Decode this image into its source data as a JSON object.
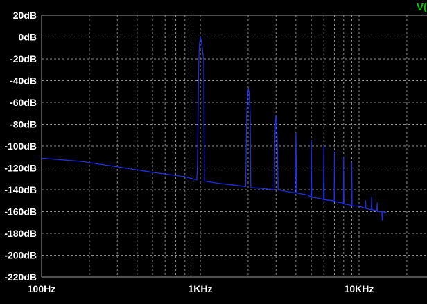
{
  "chart_data": {
    "type": "line",
    "title": "",
    "xlabel": "",
    "ylabel": "",
    "x_scale": "log",
    "xlim": [
      100,
      15000
    ],
    "ylim": [
      -220,
      20
    ],
    "grid": true,
    "y_ticks": [
      {
        "value": 20,
        "label": "20dB"
      },
      {
        "value": 0,
        "label": "0dB"
      },
      {
        "value": -20,
        "label": "-20dB"
      },
      {
        "value": -40,
        "label": "-40dB"
      },
      {
        "value": -60,
        "label": "-60dB"
      },
      {
        "value": -80,
        "label": "-80dB"
      },
      {
        "value": -100,
        "label": "-100dB"
      },
      {
        "value": -120,
        "label": "-120dB"
      },
      {
        "value": -140,
        "label": "-140dB"
      },
      {
        "value": -160,
        "label": "-160dB"
      },
      {
        "value": -180,
        "label": "-180dB"
      },
      {
        "value": -200,
        "label": "-200dB"
      },
      {
        "value": -220,
        "label": "-220dB"
      }
    ],
    "x_ticks": [
      {
        "value": 100,
        "label": "100Hz"
      },
      {
        "value": 1000,
        "label": "1KHz"
      },
      {
        "value": 10000,
        "label": "10KHz"
      }
    ],
    "trace_label": "V(",
    "series": [
      {
        "name": "",
        "color": "#1f2fe0",
        "points": [
          [
            100,
            -111
          ],
          [
            180,
            -114
          ],
          [
            300,
            -119
          ],
          [
            500,
            -124
          ],
          [
            800,
            -128
          ],
          [
            950,
            -131
          ],
          [
            960,
            -118
          ],
          [
            975,
            -30
          ],
          [
            985,
            -8
          ],
          [
            1000,
            0
          ],
          [
            1015,
            -4
          ],
          [
            1030,
            -10
          ],
          [
            1050,
            -22
          ],
          [
            1060,
            -132
          ],
          [
            1300,
            -134
          ],
          [
            1700,
            -136
          ],
          [
            1930,
            -137
          ],
          [
            1960,
            -70
          ],
          [
            1990,
            -50
          ],
          [
            2010,
            -47
          ],
          [
            2030,
            -52
          ],
          [
            2060,
            -70
          ],
          [
            2080,
            -138
          ],
          [
            2500,
            -139
          ],
          [
            2920,
            -140
          ],
          [
            2950,
            -90
          ],
          [
            2990,
            -72
          ],
          [
            3020,
            -76
          ],
          [
            3060,
            -100
          ],
          [
            3090,
            -140
          ],
          [
            3600,
            -142
          ],
          [
            3960,
            -143
          ],
          [
            4000,
            -88
          ],
          [
            4040,
            -143
          ],
          [
            4800,
            -145
          ],
          [
            4970,
            -147
          ],
          [
            5000,
            -95
          ],
          [
            5030,
            -147
          ],
          [
            5700,
            -148
          ],
          [
            5970,
            -149
          ],
          [
            6000,
            -100
          ],
          [
            6030,
            -149
          ],
          [
            6800,
            -150
          ],
          [
            6970,
            -151
          ],
          [
            7000,
            -105
          ],
          [
            7030,
            -151
          ],
          [
            7800,
            -152
          ],
          [
            7970,
            -153
          ],
          [
            8000,
            -110
          ],
          [
            8030,
            -153
          ],
          [
            8800,
            -154
          ],
          [
            8970,
            -155
          ],
          [
            9000,
            -115
          ],
          [
            9030,
            -155
          ],
          [
            10000,
            -155
          ],
          [
            10950,
            -157
          ],
          [
            11000,
            -150
          ],
          [
            11050,
            -157
          ],
          [
            11600,
            -158
          ],
          [
            11950,
            -158
          ],
          [
            12000,
            -147
          ],
          [
            12050,
            -158
          ],
          [
            12600,
            -159
          ],
          [
            12950,
            -159
          ],
          [
            13000,
            -152
          ],
          [
            13050,
            -160
          ],
          [
            13700,
            -160
          ],
          [
            13900,
            -160
          ],
          [
            14000,
            -168
          ],
          [
            14100,
            -160
          ],
          [
            15000,
            -161
          ]
        ]
      }
    ]
  }
}
